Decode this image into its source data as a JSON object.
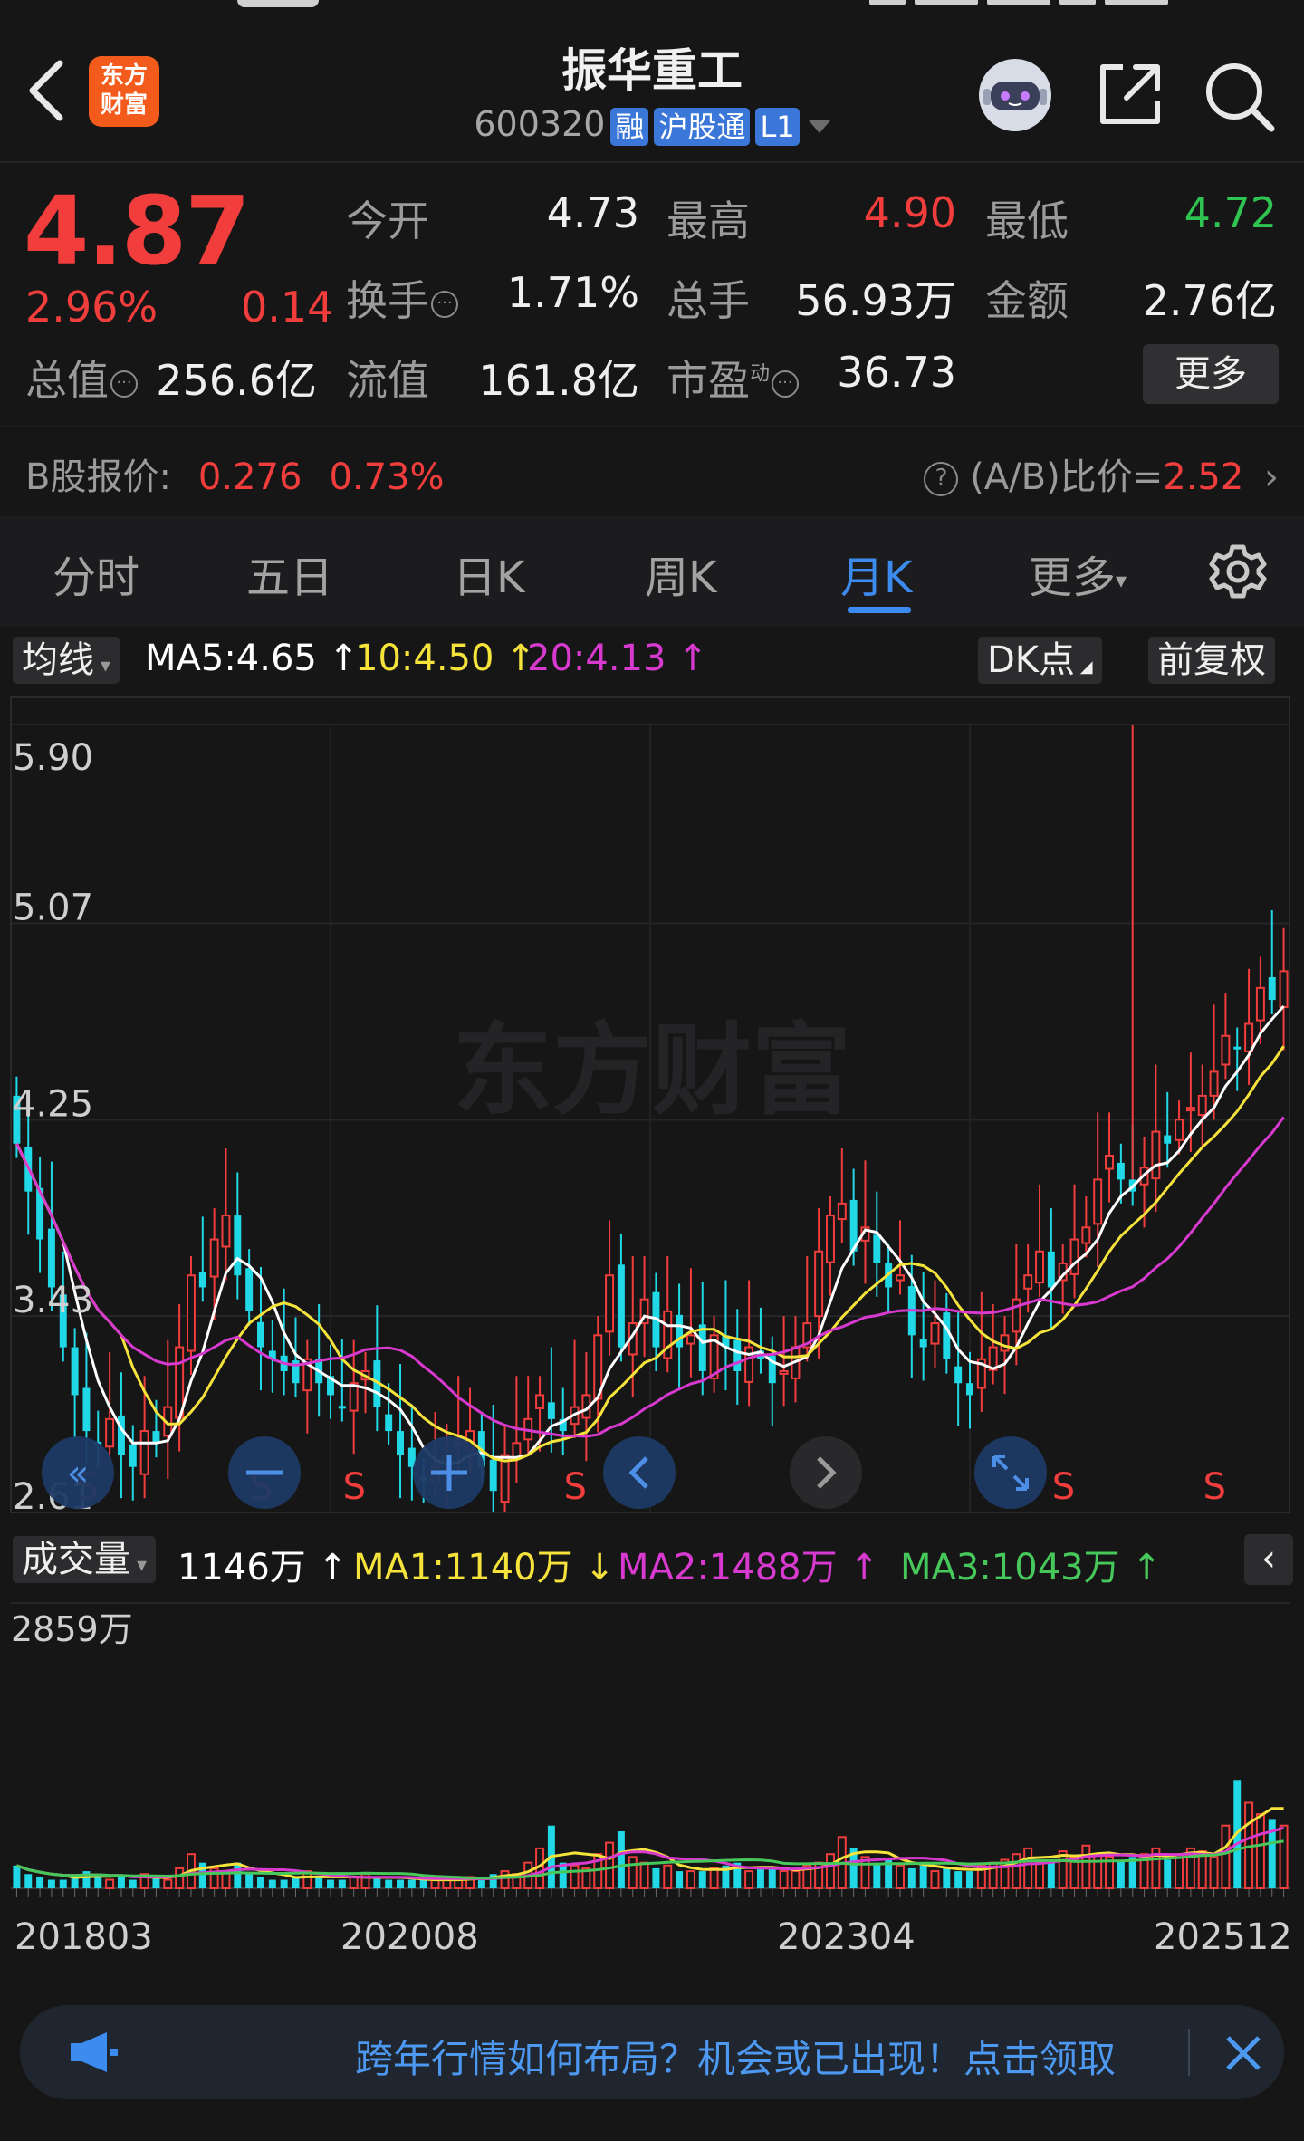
{
  "header": {
    "logo_line1": "东方",
    "logo_line2": "财富",
    "stock_name": "振华重工",
    "stock_code": "600320",
    "badges": [
      "融",
      "沪股通",
      "L1"
    ]
  },
  "quote": {
    "price": "4.87",
    "change_pct": "2.96%",
    "change_abs": "0.14",
    "fields": {
      "open_label": "今开",
      "open": "4.73",
      "high_label": "最高",
      "high": "4.90",
      "low_label": "最低",
      "low": "4.72",
      "turnover_label": "换手",
      "turnover": "1.71%",
      "volume_label": "总手",
      "volume": "56.93万",
      "amount_label": "金额",
      "amount": "2.76亿",
      "mktcap_label": "总值",
      "mktcap": "256.6亿",
      "float_label": "流值",
      "float": "161.8亿",
      "pe_label": "市盈",
      "pe_sup": "动",
      "pe": "36.73"
    },
    "more_label": "更多",
    "bshare_label": "B股报价:",
    "bshare_price": "0.276",
    "bshare_pct": "0.73%",
    "ab_ratio_label": "(A/B)比价=",
    "ab_ratio": "2.52"
  },
  "tabs": [
    "分时",
    "五日",
    "日K",
    "周K",
    "月K",
    "更多"
  ],
  "active_tab": "月K",
  "ma_bar": {
    "dropdown": "均线",
    "ma5": "MA5:4.65",
    "ma10": "10:4.50",
    "ma20": "20:4.13",
    "dk_label": "DK点",
    "adjust_label": "前复权"
  },
  "vol_bar": {
    "dropdown": "成交量",
    "vol": "1146万",
    "ma1": "MA1:1140万",
    "ma2": "MA2:1488万",
    "ma3": "MA3:1043万"
  },
  "colors": {
    "up": "#f23d3d",
    "down": "#21d9e6",
    "ma5": "#ffffff",
    "ma10": "#f5e33b",
    "ma20": "#d83ad0",
    "vol_ma3": "#47c85a",
    "accent": "#3c8cf0"
  },
  "chart_data": {
    "type": "candlestick",
    "watermark": "东方财富",
    "y_ticks": [
      "5.90",
      "5.07",
      "4.25",
      "3.43",
      "2.61"
    ],
    "ylim": [
      2.61,
      5.9
    ],
    "x_ticks": [
      "201803",
      "202008",
      "202304",
      "202512"
    ],
    "vol_max_label": "2859万",
    "signals": [
      "S",
      "S",
      "S",
      "S",
      "S",
      "S"
    ],
    "closes": [
      4.15,
      3.95,
      3.75,
      3.55,
      3.3,
      3.1,
      2.95,
      2.9,
      3.0,
      2.85,
      2.8,
      2.95,
      2.9,
      3.05,
      3.3,
      3.6,
      3.55,
      3.75,
      3.85,
      3.6,
      3.45,
      3.3,
      3.25,
      3.2,
      3.15,
      3.25,
      3.15,
      3.1,
      3.05,
      3.15,
      3.2,
      3.05,
      2.95,
      2.85,
      2.8,
      2.75,
      2.8,
      2.85,
      2.9,
      2.95,
      2.8,
      2.7,
      2.85,
      2.9,
      3.0,
      3.1,
      3.0,
      2.95,
      3.05,
      3.1,
      3.35,
      3.6,
      3.3,
      3.4,
      3.5,
      3.3,
      3.45,
      3.3,
      3.35,
      3.2,
      3.35,
      3.3,
      3.2,
      3.3,
      3.25,
      3.15,
      3.2,
      3.3,
      3.4,
      3.7,
      3.85,
      3.9,
      3.7,
      3.8,
      3.65,
      3.55,
      3.6,
      3.35,
      3.3,
      3.4,
      3.25,
      3.15,
      3.1,
      3.25,
      3.3,
      3.35,
      3.5,
      3.6,
      3.7,
      3.55,
      3.65,
      3.75,
      3.8,
      4.0,
      4.1,
      4.0,
      3.95,
      4.05,
      4.2,
      4.15,
      4.25,
      4.3,
      4.35,
      4.45,
      4.6,
      4.55,
      4.65,
      4.8,
      4.75,
      4.87
    ],
    "volumes_pct": [
      8,
      5,
      4,
      3,
      3,
      4,
      6,
      5,
      3,
      4,
      3,
      5,
      4,
      3,
      7,
      12,
      9,
      7,
      6,
      9,
      5,
      4,
      3,
      3,
      4,
      6,
      4,
      3,
      3,
      4,
      5,
      4,
      3,
      3,
      3,
      3,
      3,
      3,
      3,
      4,
      4,
      5,
      6,
      5,
      9,
      14,
      22,
      9,
      8,
      7,
      12,
      16,
      20,
      11,
      9,
      7,
      8,
      6,
      6,
      6,
      7,
      8,
      9,
      6,
      7,
      7,
      6,
      6,
      8,
      9,
      12,
      18,
      14,
      11,
      9,
      10,
      8,
      7,
      8,
      6,
      7,
      6,
      6,
      8,
      9,
      10,
      12,
      14,
      9,
      10,
      13,
      11,
      15,
      12,
      11,
      10,
      11,
      12,
      14,
      10,
      12,
      14,
      13,
      11,
      22,
      38,
      30,
      26,
      24,
      22
    ]
  },
  "banner": {
    "text": "跨年行情如何布局？机会或已出现！点击领取"
  }
}
